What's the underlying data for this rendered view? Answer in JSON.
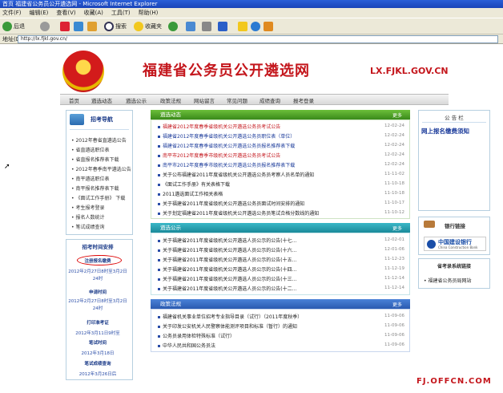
{
  "window": {
    "title": "首页 福建省公务员公开遴选网 - Microsoft Internet Explorer"
  },
  "menu": [
    "文件(F)",
    "编辑(E)",
    "查看(V)",
    "收藏(A)",
    "工具(T)",
    "帮助(H)"
  ],
  "toolbar": {
    "back": "后退",
    "search": "搜索",
    "favorites": "收藏夹"
  },
  "address": {
    "label": "地址(D)",
    "url": "http://lx.fjkl.gov.cn/"
  },
  "site": {
    "title": "福建省公务员公开遴选网",
    "domain": "LX.FJKL.GOV.CN"
  },
  "nav": [
    "首页",
    "遴选动态",
    "遴选公示",
    "政策法规",
    "网站留言",
    "常见问题",
    "成绩查询",
    "报考登录"
  ],
  "left_nav": {
    "title": "招考导航",
    "items": [
      "2012年春省直遴选公告",
      "省直遴选职位表",
      "省直报名推荐表下载",
      "2012年春季南平遴选公告",
      "南平遴选职位表",
      "南平报名推荐表下载",
      "《面试工作手册》 下载",
      "考生报考登录",
      "报名人数统计",
      "笔试成绩查询"
    ]
  },
  "schedule": {
    "title": "招考时间安排",
    "register": "注册报名缴费",
    "register_time": "2012年2月27日8时至3月2日24时",
    "apply": "申请时间",
    "apply_time": "2012年2月27日8时至3月2日24时",
    "print": "打印准考证",
    "print_time": "2012年3月11日9时至",
    "exam": "笔试时间",
    "exam_time": "2012年3月18日",
    "score": "笔试成绩查询",
    "score_time": "2012年3月26日后"
  },
  "dynamics": {
    "title": "遴选动态",
    "more": "更多",
    "items": [
      {
        "text": "福建省2012年度春季省级机关公开遴选公务员考试公告",
        "date": "12-02-24",
        "color": "#c4161c"
      },
      {
        "text": "福建省2012年度春季省级机关公开遴选公务员职位表（单位）",
        "date": "12-02-24",
        "color": "#1a3a9a"
      },
      {
        "text": "福建省2012年度春季省级机关公开遴选公务员报名推荐表下载",
        "date": "12-02-24",
        "color": "#1a3a9a"
      },
      {
        "text": "南平市2012年度春季市级机关公开遴选公务员考试公告",
        "date": "12-02-24",
        "color": "#c4161c"
      },
      {
        "text": "南平市2012年度春季市级机关公开遴选公务员报名推荐表下载",
        "date": "12-02-24",
        "color": "#1a3a9a"
      },
      {
        "text": "关于公布福建省2011年度省级机关公开遴选公务员考察人员名单的通知",
        "date": "11-11-02",
        "color": "#222"
      },
      {
        "text": "《面试工作手册》有关表格下载",
        "date": "11-10-18",
        "color": "#222"
      },
      {
        "text": "2011遴选面试工作相关表格",
        "date": "11-10-18",
        "color": "#222"
      },
      {
        "text": "关于福建省2011年度省级机关公开遴选公务员面试时间安排的通知",
        "date": "11-10-17",
        "color": "#222"
      },
      {
        "text": "关于划定福建省2011年度省级机关公开遴选公务员笔试合格分数线的通知",
        "date": "11-10-12",
        "color": "#222"
      }
    ]
  },
  "publicity": {
    "title": "遴选公示",
    "more": "更多",
    "items": [
      {
        "text": "关于福建省2011年度省级机关公开遴选人员公示的公告(十七...",
        "date": "12-02-01"
      },
      {
        "text": "关于福建省2011年度省级机关公开遴选人员公示的公告(十六...",
        "date": "12-01-06"
      },
      {
        "text": "关于福建省2011年度省级机关公开遴选人员公示的公告(十五...",
        "date": "11-12-23"
      },
      {
        "text": "关于福建省2011年度省级机关公开遴选人员公示的公告(十四...",
        "date": "11-12-19"
      },
      {
        "text": "关于福建省2011年度省级机关公开遴选人员公示的公告(十三...",
        "date": "11-12-14"
      },
      {
        "text": "关于福建省2011年度省级机关公开遴选人员公示的公告(十二...",
        "date": "11-12-14"
      }
    ]
  },
  "policy": {
    "title": "政策法规",
    "more": "更多",
    "items": [
      {
        "text": "福建省机关事业单位招考专业指导目录（试行）（2011年度秋季）",
        "date": "11-09-06"
      },
      {
        "text": "关于印发公安机关人民警察体能测评项目和标准（暂行）的通知",
        "date": "11-09-06"
      },
      {
        "text": "公务员录用体检特殊标准（试行）",
        "date": "11-09-06"
      },
      {
        "text": "中华人民共和国公务员法",
        "date": "11-09-06"
      }
    ]
  },
  "bulletin": {
    "title": "公 告 栏",
    "text": "网上报名缴费须知"
  },
  "bank": {
    "title": "银行链接",
    "name": "中国建设银行",
    "en": "China Construction Bank"
  },
  "exam_links": {
    "title": "省考录系统链接",
    "item": "福建省公务员局网站"
  },
  "watermark": "FJ.OFFCN.COM"
}
